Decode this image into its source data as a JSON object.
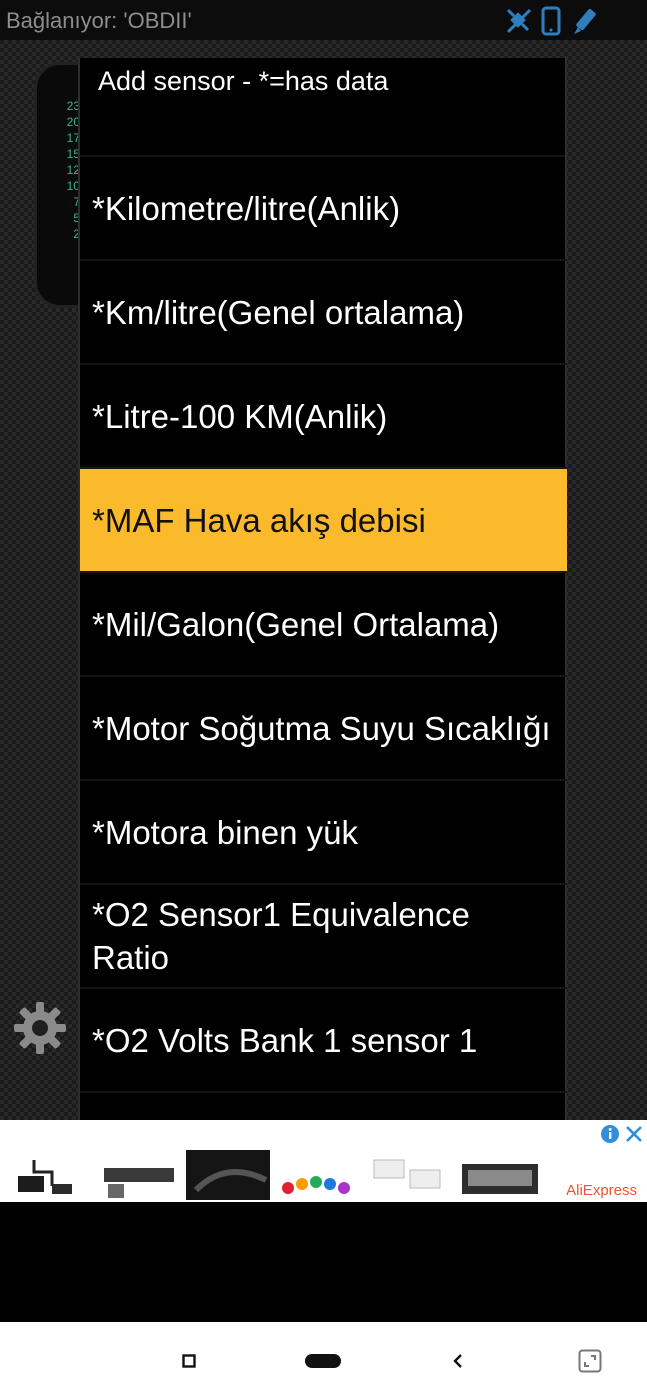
{
  "status_bar": {
    "text": "Bağlanıyor: 'OBDII'",
    "icons": [
      "satellite-off-icon",
      "phone-icon",
      "bluetooth-pen-icon"
    ]
  },
  "background": {
    "gauge_ticks": [
      "23",
      "20",
      "17",
      "15",
      "12",
      "10",
      "7",
      "5",
      "2"
    ],
    "settings_icon": "gear-icon"
  },
  "dialog": {
    "title": "Add sensor - *=has data",
    "items": [
      {
        "label": "*Kilometre/litre(Anlik)",
        "selected": false
      },
      {
        "label": "*Km/litre(Genel ortalama)",
        "selected": false
      },
      {
        "label": "*Litre-100 KM(Anlik)",
        "selected": false
      },
      {
        "label": "*MAF Hava akış debisi",
        "selected": true
      },
      {
        "label": "*Mil/Galon(Genel Ortalama)",
        "selected": false
      },
      {
        "label": "*Motor Soğutma Suyu Sıcaklığı",
        "selected": false
      },
      {
        "label": "*Motora binen yük",
        "selected": false
      },
      {
        "label": "*O2 Sensor1 Equivalence Ratio",
        "selected": false
      },
      {
        "label": "*O2 Volts Bank 1 sensor 1",
        "selected": false
      }
    ],
    "selected_color": "#fbb92c"
  },
  "ad": {
    "brand": "AliExpress",
    "icons": [
      "ad-info-icon",
      "ad-close-icon"
    ]
  },
  "nav_bar": {
    "buttons": [
      "recents-square-icon",
      "home-pill-icon",
      "back-chevron-icon",
      "screenshot-frame-icon"
    ]
  }
}
